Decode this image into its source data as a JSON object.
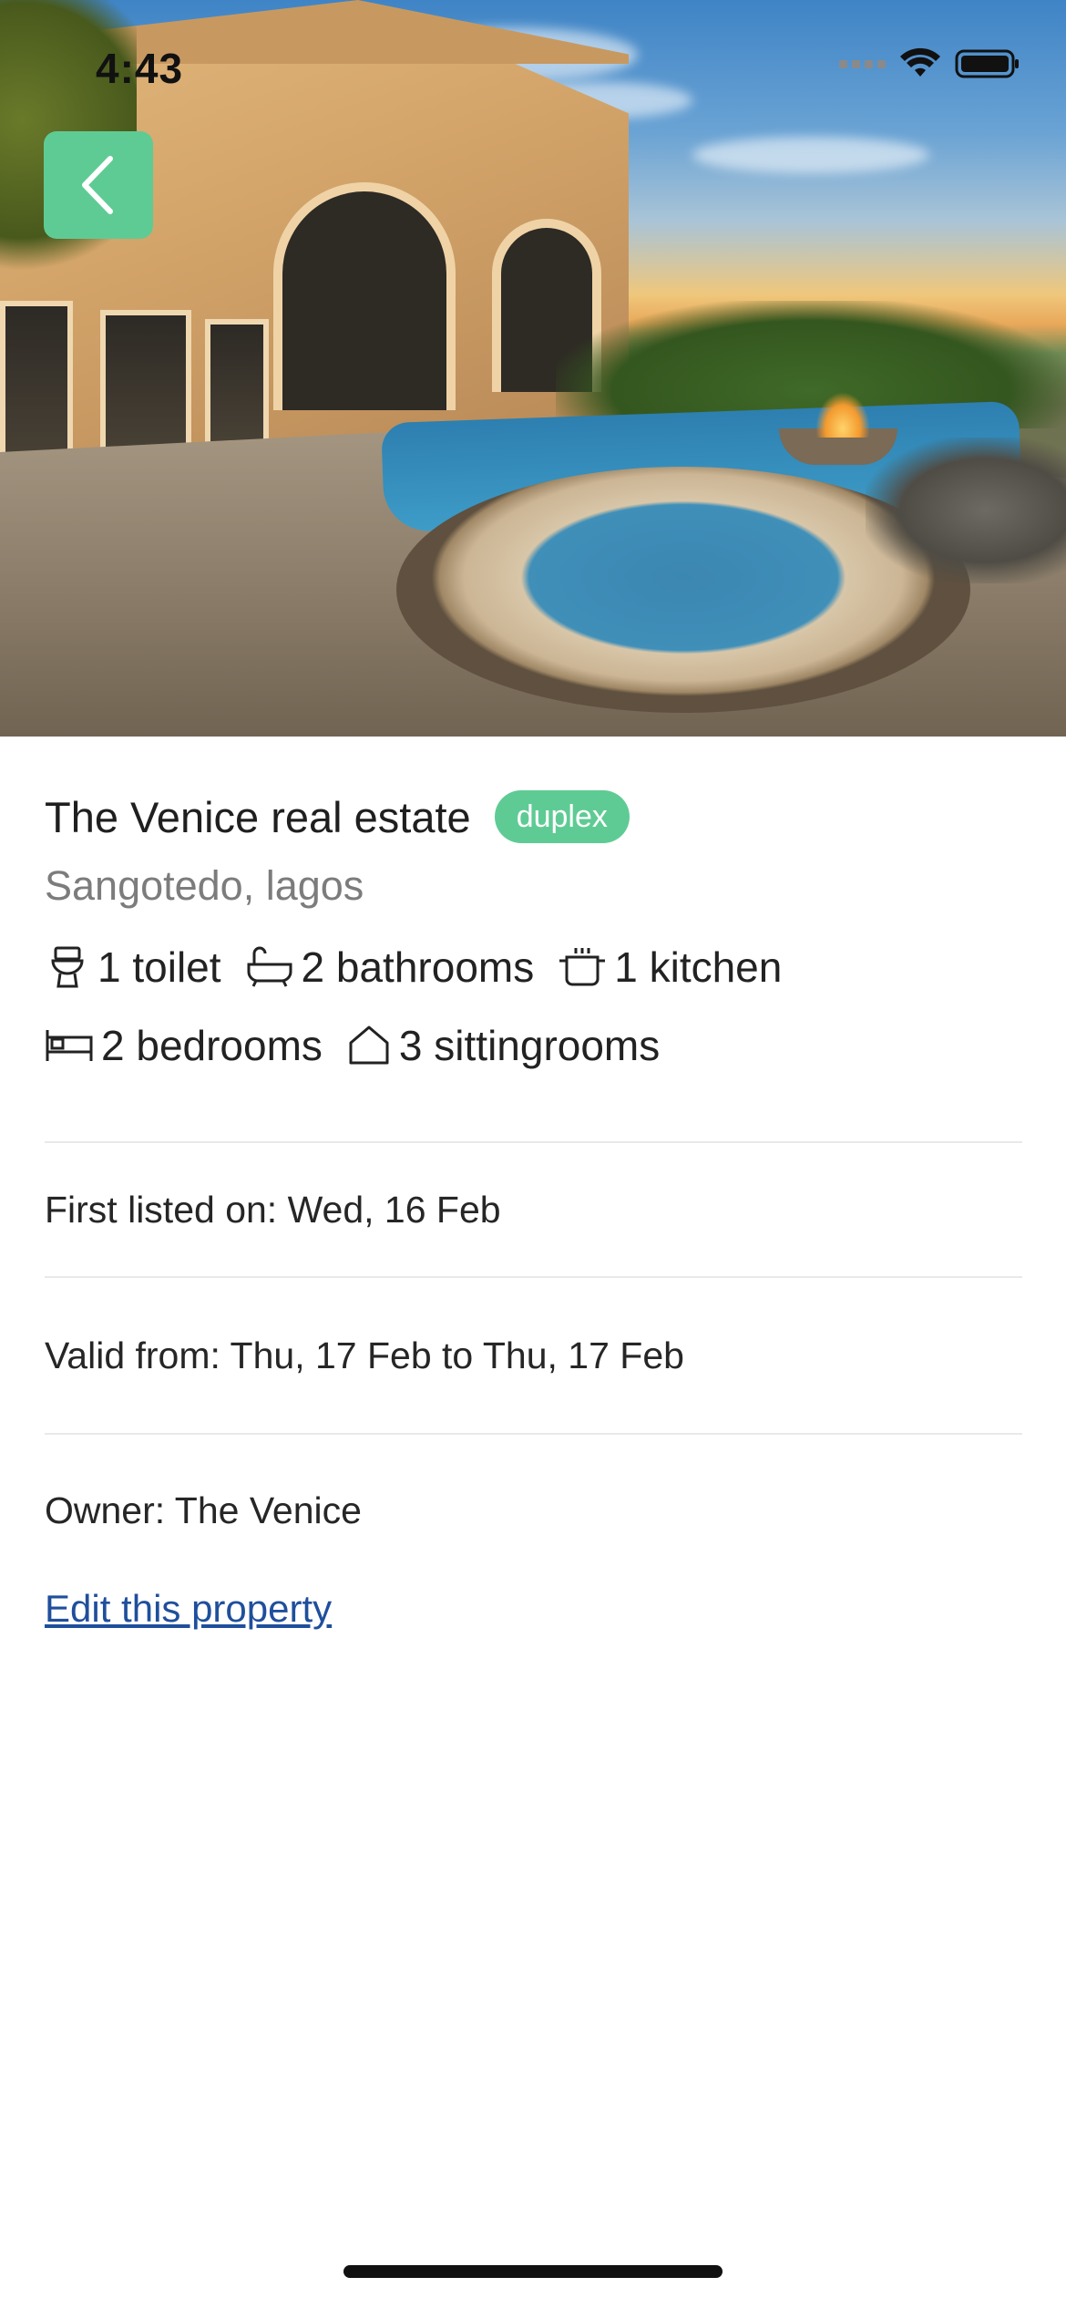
{
  "status_bar": {
    "time": "4:43"
  },
  "hero": {
    "image_alt": "Luxury villa with pool at sunset"
  },
  "back_button": {
    "icon": "chevron-left-icon",
    "color": "#5fcb94"
  },
  "property": {
    "title": "The Venice real estate",
    "type_badge": "duplex",
    "location": "Sangotedo, lagos",
    "features_row1": [
      {
        "icon": "toilet-icon",
        "label": "1 toilet"
      },
      {
        "icon": "bathtub-icon",
        "label": "2 bathrooms"
      },
      {
        "icon": "pot-icon",
        "label": "1 kitchen"
      }
    ],
    "features_row2": [
      {
        "icon": "bed-icon",
        "label": "2 bedrooms"
      },
      {
        "icon": "house-icon",
        "label": "3 sittingrooms"
      }
    ],
    "first_listed": "First listed on: Wed, 16 Feb",
    "valid_range": "Valid from: Thu, 17 Feb to Thu, 17 Feb",
    "owner": "Owner: The Venice",
    "edit_link": "Edit this property"
  },
  "colors": {
    "accent": "#5fcb94",
    "link": "#1f4f9c",
    "muted": "#7c7c7c"
  }
}
